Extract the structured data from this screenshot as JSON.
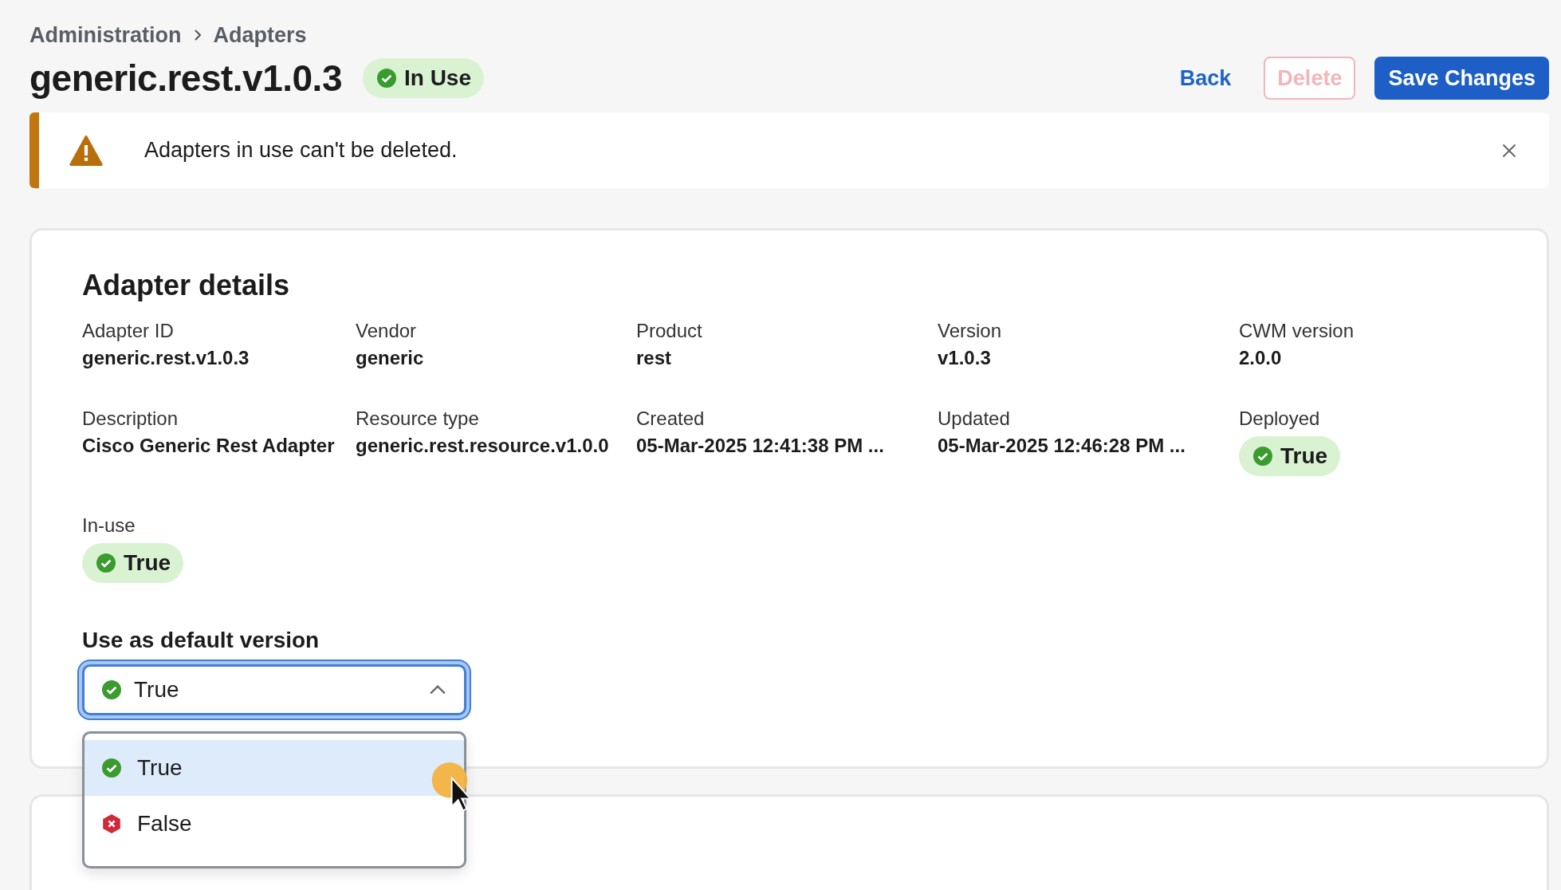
{
  "breadcrumb": [
    {
      "label": "Administration"
    },
    {
      "label": "Adapters"
    }
  ],
  "title": "generic.rest.v1.0.3",
  "status_badge": {
    "label": "In Use",
    "kind": "success"
  },
  "actions": [
    {
      "label": "Back",
      "kind": "link",
      "disabled": false
    },
    {
      "label": "Delete",
      "kind": "danger",
      "disabled": true
    },
    {
      "label": "Save Changes",
      "kind": "primary",
      "disabled": false
    }
  ],
  "alert": {
    "kind": "warning",
    "message": "Adapters in use can't be deleted."
  },
  "details": {
    "title": "Adapter details",
    "fields": [
      {
        "label": "Adapter ID",
        "kind": "text",
        "value": "generic.rest.v1.0.3"
      },
      {
        "label": "Vendor",
        "kind": "text",
        "value": "generic"
      },
      {
        "label": "Product",
        "kind": "text",
        "value": "rest"
      },
      {
        "label": "Version",
        "kind": "text",
        "value": "v1.0.3"
      },
      {
        "label": "CWM version",
        "kind": "text",
        "value": "2.0.0"
      },
      {
        "label": "Description",
        "kind": "text",
        "value": "Cisco Generic Rest Adapter"
      },
      {
        "label": "Resource type",
        "kind": "text",
        "value": "generic.rest.resource.v1.0.0"
      },
      {
        "label": "Created",
        "kind": "text",
        "value": "05-Mar-2025 12:41:38 PM ..."
      },
      {
        "label": "Updated",
        "kind": "text",
        "value": "05-Mar-2025 12:46:28 PM ..."
      },
      {
        "label": "Deployed",
        "kind": "badge",
        "value": "True"
      },
      {
        "label": "In-use",
        "kind": "badge",
        "value": "True"
      }
    ],
    "default_version": {
      "label": "Use as default version",
      "value": "True",
      "expanded": true,
      "options": [
        {
          "label": "True",
          "kind": "positive",
          "selected": true
        },
        {
          "label": "False",
          "kind": "negative",
          "selected": false
        }
      ]
    }
  }
}
